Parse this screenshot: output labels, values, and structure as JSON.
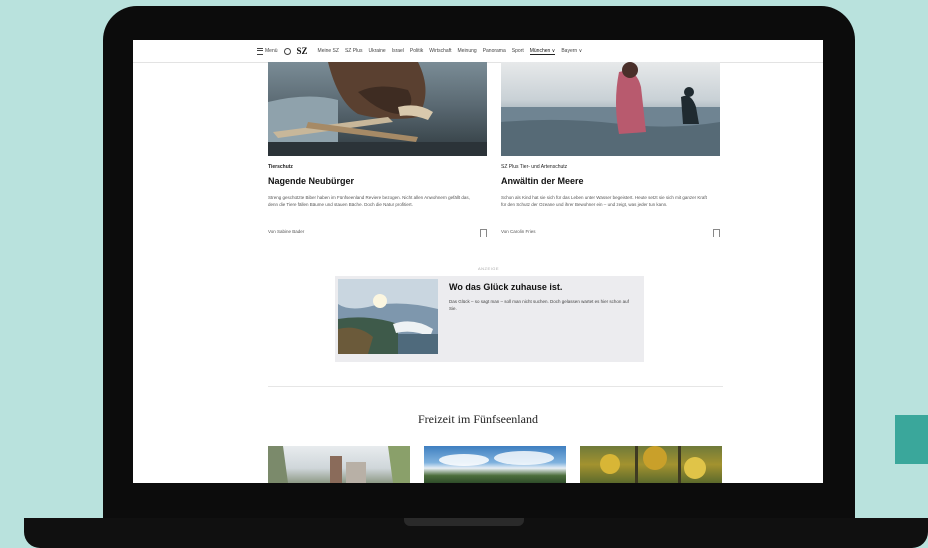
{
  "nav": {
    "menu_label": "Menü",
    "logo": "SZ",
    "links": [
      "Meine SZ",
      "SZ Plus",
      "Ukraine",
      "Israel",
      "Politik",
      "Wirtschaft",
      "Meinung",
      "Panorama",
      "Sport",
      "München ∨",
      "Bayern ∨"
    ],
    "active_index": 9
  },
  "cards": [
    {
      "kicker": "Tierschutz",
      "title": "Nagende Neubürger",
      "teaser": "Streng geschützte Biber haben im Fünfseenland Reviere bezogen. Nicht allen Anwohnern gefällt das, denn die Tiere fällen Bäume und stauen Bäche. Doch die Natur profitiert.",
      "author": "Von Sabine Bader"
    },
    {
      "kicker": "SZ Plus  Tier- und Artenschutz",
      "title": "Anwältin der Meere",
      "teaser": "Schon als Kind hat sie sich für das Leben unter Wasser begeistert. Heute setzt sie sich mit ganzer Kraft für den Schutz der Ozeane und ihrer Bewohner ein – und zeigt, was jeder tun kann.",
      "author": "Von Carolin Fries"
    }
  ],
  "ad": {
    "label": "ANZEIGE",
    "headline": "Wo das Glück zuhause ist.",
    "text": "Das Glück – so sagt man – soll man nicht suchen. Doch gelassen wartet es hier schon auf Sie."
  },
  "section": {
    "title": "Freizeit im Fünfseenland"
  },
  "colors": {
    "background": "#b9e2dd",
    "accent_square": "#3aa79b",
    "laptop": "#0c0c0c"
  }
}
